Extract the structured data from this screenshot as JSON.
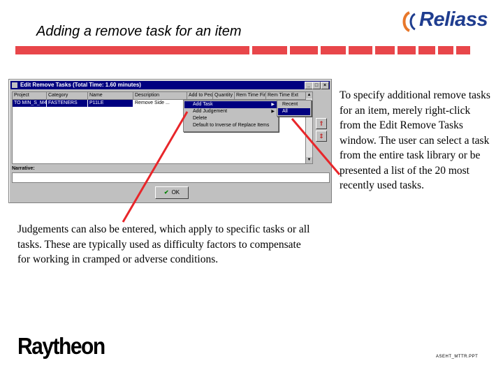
{
  "slide": {
    "title": "Adding a remove task for an item",
    "logo_text": "Reliass",
    "company_logo": "Raytheon",
    "footer_file": "ASEHT_MTTR.PPT",
    "colors": {
      "accent_red": "#e8464a",
      "logo_blue": "#1f3d8f",
      "arrow_red": "#e8262a"
    }
  },
  "window": {
    "title": "Edit Remove Tasks (Total Time: 1.60 minutes)",
    "controls": [
      "_",
      "□",
      "×"
    ],
    "columns": [
      "Project",
      "Category",
      "Name",
      "Description",
      "Add to People",
      "Quantity",
      "Rem Time First",
      "Rem Time Ext"
    ],
    "row": [
      "TO MIN_S_M4Z",
      "FASTENERS",
      "P11LE",
      "Remove Side ..."
    ],
    "narrative_label": "Narrative:",
    "ok_label": "OK",
    "context_menu": [
      {
        "label": "Add Task",
        "has_sub": true,
        "selected": true
      },
      {
        "label": "Add Judgement",
        "has_sub": true,
        "selected": false
      },
      {
        "label": "Delete",
        "has_sub": false,
        "selected": false
      },
      {
        "label": "Default to Inverse of Replace Items",
        "has_sub": false,
        "selected": false
      }
    ],
    "submenu": [
      {
        "label": "Recent",
        "selected": false
      },
      {
        "label": "All",
        "selected": true
      }
    ]
  },
  "text": {
    "right": "To specify additional remove tasks for an item, merely right-click from the Edit Remove Tasks window. The user can select a task from the entire task library or be presented a list of the 20 most recently used tasks.",
    "bottom": "Judgements can also be entered, which apply to specific tasks or all tasks. These are typically used as difficulty factors to compensate for working in cramped or adverse conditions."
  }
}
